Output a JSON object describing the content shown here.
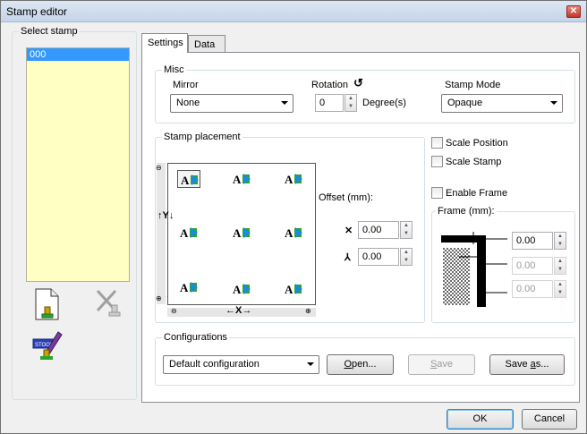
{
  "window": {
    "title": "Stamp editor"
  },
  "left_panel": {
    "select_label": "Select stamp",
    "stamps": [
      "000"
    ]
  },
  "tabs": [
    "Settings",
    "Data"
  ],
  "misc": {
    "label": "Misc",
    "mirror_label": "Mirror",
    "mirror_value": "None",
    "rotation_label": "Rotation",
    "rotation_value": "0",
    "rotation_unit": "Degree(s)",
    "stamp_mode_label": "Stamp Mode",
    "stamp_mode_value": "Opaque"
  },
  "placement": {
    "label": "Stamp placement",
    "offset_label": "Offset (mm):",
    "offset_x": "0.00",
    "offset_y": "0.00",
    "x_axis": "←X→",
    "y_axis": "↑Y↓",
    "x_symbol": "✕",
    "y_symbol": "⅄",
    "stamp_glyph": "A"
  },
  "options": {
    "scale_position": "Scale Position",
    "scale_stamp": "Scale Stamp",
    "enable_frame": "Enable Frame",
    "frame_label": "Frame (mm):",
    "frame_values": [
      "0.00",
      "0.00",
      "0.00"
    ]
  },
  "configurations": {
    "label": "Configurations",
    "selected": "Default configuration",
    "open_prefix": "",
    "open_accel": "O",
    "open_rest": "pen...",
    "save_accel": "S",
    "save_rest": "ave",
    "save_as_prefix": "Save ",
    "save_as_accel": "a",
    "save_as_rest": "s..."
  },
  "footer": {
    "ok": "OK",
    "cancel": "Cancel"
  },
  "colors": {
    "selection": "#3399ff",
    "list_bg": "#ffffc4",
    "stamp_blue": "#1a8cd8",
    "stamp_green": "#2aa52a"
  }
}
